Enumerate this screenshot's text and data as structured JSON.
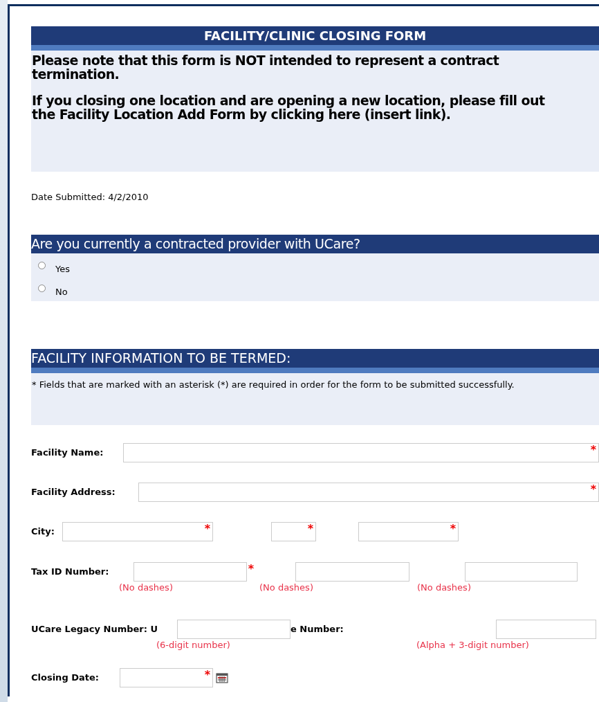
{
  "form_title": "FACILITY/CLINIC CLOSING FORM",
  "notice": [
    "Please note that this form is NOT intended to represent a contract termination.",
    "If you closing one location and are opening a new location, please fill out the Facility Location Add Form by clicking here (insert link)."
  ],
  "date_submitted": "Date Submitted: 4/2/2010",
  "question": {
    "title": "Are you currently a contracted provider with UCare?",
    "options": [
      {
        "label": "Yes",
        "selected": false
      },
      {
        "label": "No",
        "selected": false
      }
    ]
  },
  "section": {
    "title": "FACILITY INFORMATION TO BE TERMED:",
    "note": "* Fields that are marked with an asterisk (*) are required in order for the form to be submitted successfully."
  },
  "rows": [
    {
      "kind": "name",
      "label": "Facility Name:",
      "fields": [
        {
          "asterisk": "*"
        }
      ]
    },
    {
      "kind": "address",
      "label": "Facility Address:",
      "fields": [
        {
          "asterisk": "*"
        }
      ]
    },
    {
      "kind": "city",
      "label": "City:",
      "fields": [
        {
          "asterisk": "*"
        },
        {
          "asterisk": "*"
        },
        {
          "asterisk": "*"
        }
      ]
    },
    {
      "kind": "tax",
      "label": "Tax ID Number:",
      "fields": [
        {
          "asterisk": "*",
          "hint": "(No dashes)"
        },
        {
          "hint": "(No dashes)"
        },
        {
          "hint": "(No dashes)"
        }
      ]
    },
    {
      "kind": "legacy",
      "label": "UCare Legacy Number:  U",
      "fields": [
        {
          "hint": "(6-digit number)"
        },
        {
          "label": "e Number:",
          "hint": "(Alpha + 3-digit number)"
        }
      ]
    },
    {
      "kind": "date",
      "label": "Closing Date:",
      "fields": [
        {
          "asterisk": "*",
          "calendar": true
        }
      ]
    }
  ]
}
